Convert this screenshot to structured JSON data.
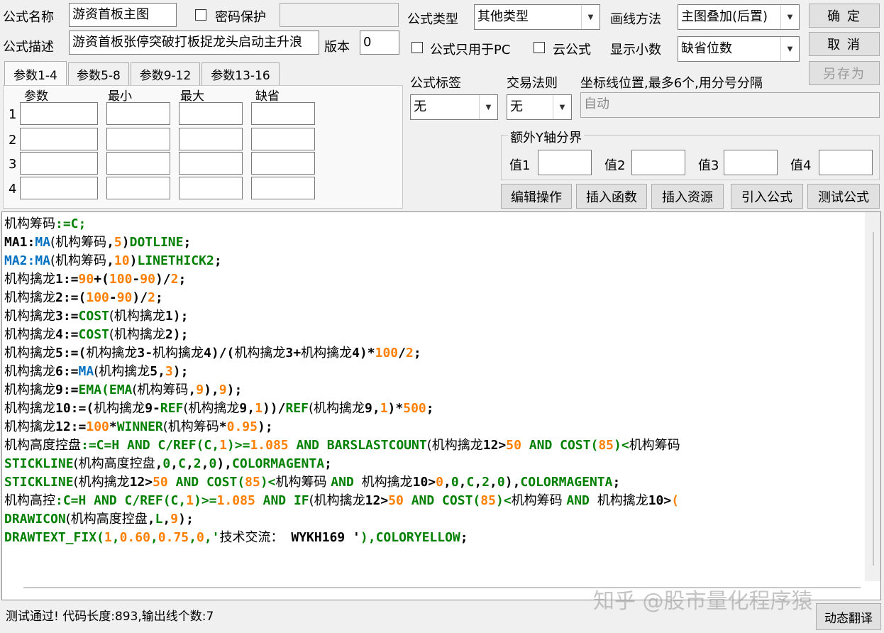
{
  "header": {
    "name_label": "公式名称",
    "name_value": "游资首板主图",
    "password_label": "密码保护",
    "desc_label": "公式描述",
    "desc_value": "游资首板张停突破打板捉龙头启动主升浪",
    "version_label": "版本",
    "version_value": "0"
  },
  "type": {
    "type_label": "公式类型",
    "type_value": "其他类型",
    "draw_label": "画线方法",
    "draw_value": "主图叠加(后置)",
    "pc_only_label": "公式只用于PC",
    "cloud_label": "云公式",
    "decimal_label": "显示小数",
    "decimal_value": "缺省位数"
  },
  "buttons": {
    "ok": "确  定",
    "cancel": "取  消",
    "save_as": "另存为",
    "edit_ops": "编辑操作",
    "insert_func": "插入函数",
    "insert_resource": "插入资源",
    "import_formula": "引入公式",
    "test_formula": "测试公式",
    "translate": "动态翻译"
  },
  "tabs": [
    "参数1-4",
    "参数5-8",
    "参数9-12",
    "参数13-16"
  ],
  "params": {
    "headers": [
      "参数",
      "最小",
      "最大",
      "缺省"
    ],
    "rows": [
      "1",
      "2",
      "3",
      "4"
    ]
  },
  "tags": {
    "tag_label": "公式标签",
    "tag_value": "无",
    "rule_label": "交易法则",
    "rule_value": "无",
    "axis_label": "坐标线位置,最多6个,用分号分隔",
    "axis_value": "自动"
  },
  "yaxis": {
    "group_label": "额外Y轴分界",
    "v1": "值1",
    "v2": "值2",
    "v3": "值3",
    "v4": "值4"
  },
  "code_lines": [
    [
      [
        "t",
        "机构筹码"
      ],
      [
        "",
        ""
      ],
      [
        "k",
        ":=C;"
      ]
    ],
    [
      [
        "b",
        "MA1:"
      ],
      [
        "f",
        "MA"
      ],
      [
        "t",
        "(机构筹码"
      ],
      [
        "b",
        ","
      ],
      [
        "n",
        "5"
      ],
      [
        "b",
        ")"
      ],
      [
        "k",
        "DOTLINE"
      ],
      [
        "b",
        ";"
      ]
    ],
    [
      [
        "f",
        "MA2:MA"
      ],
      [
        "t",
        "(机构筹码"
      ],
      [
        "b",
        ","
      ],
      [
        "n",
        "10"
      ],
      [
        "b",
        ")"
      ],
      [
        "k",
        "LINETHICK2"
      ],
      [
        "b",
        ";"
      ]
    ],
    [
      [
        "t",
        "机构擒龙"
      ],
      [
        "b",
        "1:="
      ],
      [
        "n",
        "90"
      ],
      [
        "b",
        "+("
      ],
      [
        "n",
        "100"
      ],
      [
        "b",
        "-"
      ],
      [
        "n",
        "90"
      ],
      [
        "b",
        ")/"
      ],
      [
        "n",
        "2"
      ],
      [
        "b",
        ";"
      ]
    ],
    [
      [
        "t",
        "机构擒龙"
      ],
      [
        "b",
        "2:=("
      ],
      [
        "n",
        "100"
      ],
      [
        "b",
        "-"
      ],
      [
        "n",
        "90"
      ],
      [
        "b",
        ")/"
      ],
      [
        "n",
        "2"
      ],
      [
        "b",
        ";"
      ]
    ],
    [
      [
        "t",
        "机构擒龙"
      ],
      [
        "b",
        "3:="
      ],
      [
        "k",
        "COST"
      ],
      [
        "t",
        "(机构擒龙"
      ],
      [
        "b",
        "1);"
      ]
    ],
    [
      [
        "t",
        "机构擒龙"
      ],
      [
        "b",
        "4:="
      ],
      [
        "k",
        "COST"
      ],
      [
        "t",
        "(机构擒龙"
      ],
      [
        "b",
        "2);"
      ]
    ],
    [
      [
        "t",
        "机构擒龙"
      ],
      [
        "b",
        "5:=("
      ],
      [
        "t",
        "机构擒龙"
      ],
      [
        "b",
        "3-"
      ],
      [
        "t",
        "机构擒龙"
      ],
      [
        "b",
        "4)/("
      ],
      [
        "t",
        "机构擒龙"
      ],
      [
        "b",
        "3+"
      ],
      [
        "t",
        "机构擒龙"
      ],
      [
        "b",
        "4)*"
      ],
      [
        "n",
        "100"
      ],
      [
        "b",
        "/"
      ],
      [
        "n",
        "2"
      ],
      [
        "b",
        ";"
      ]
    ],
    [
      [
        "t",
        "机构擒龙"
      ],
      [
        "b",
        "6:="
      ],
      [
        "f",
        "MA"
      ],
      [
        "t",
        "(机构擒龙"
      ],
      [
        "b",
        "5,"
      ],
      [
        "n",
        "3"
      ],
      [
        "b",
        ");"
      ]
    ],
    [
      [
        "t",
        "机构擒龙"
      ],
      [
        "b",
        "9:="
      ],
      [
        "k",
        "EMA(EMA"
      ],
      [
        "t",
        "(机构筹码"
      ],
      [
        "b",
        ","
      ],
      [
        "n",
        "9"
      ],
      [
        "b",
        "),"
      ],
      [
        "n",
        "9"
      ],
      [
        "b",
        ");"
      ]
    ],
    [
      [
        "t",
        "机构擒龙"
      ],
      [
        "b",
        "10:=("
      ],
      [
        "t",
        "机构擒龙"
      ],
      [
        "b",
        "9-"
      ],
      [
        "k",
        "REF"
      ],
      [
        "t",
        "(机构擒龙"
      ],
      [
        "b",
        "9,"
      ],
      [
        "n",
        "1"
      ],
      [
        "b",
        "))/"
      ],
      [
        "k",
        "REF"
      ],
      [
        "t",
        "(机构擒龙"
      ],
      [
        "b",
        "9,"
      ],
      [
        "n",
        "1"
      ],
      [
        "b",
        ")*"
      ],
      [
        "n",
        "500"
      ],
      [
        "b",
        ";"
      ]
    ],
    [
      [
        "t",
        "机构擒龙"
      ],
      [
        "b",
        "12:="
      ],
      [
        "n",
        "100"
      ],
      [
        "b",
        "*"
      ],
      [
        "k",
        "WINNER"
      ],
      [
        "t",
        "(机构筹码"
      ],
      [
        "b",
        "*"
      ],
      [
        "n",
        "0.95"
      ],
      [
        "b",
        ");"
      ]
    ],
    [
      [
        "t",
        "机构高度控盘"
      ],
      [
        "k",
        ":=C=H AND C/REF(C,"
      ],
      [
        "n",
        "1"
      ],
      [
        "k",
        ")>="
      ],
      [
        "n",
        "1.085"
      ],
      [
        "k",
        " AND BARSLASTCOUNT"
      ],
      [
        "t",
        "(机构擒龙"
      ],
      [
        "b",
        "12>"
      ],
      [
        "n",
        "50"
      ],
      [
        "k",
        " AND COST("
      ],
      [
        "n",
        "85"
      ],
      [
        "k",
        ")<"
      ],
      [
        "t",
        "机构筹码"
      ]
    ],
    [
      [
        "k",
        "STICKLINE"
      ],
      [
        "t",
        "(机构高度控盘"
      ],
      [
        "b",
        ","
      ],
      [
        "k",
        "0"
      ],
      [
        "b",
        ","
      ],
      [
        "k",
        "C"
      ],
      [
        "b",
        ","
      ],
      [
        "k",
        "2"
      ],
      [
        "b",
        ","
      ],
      [
        "k",
        "0"
      ],
      [
        "b",
        "),"
      ],
      [
        "k",
        "COLORMAGENTA"
      ],
      [
        "b",
        ";"
      ]
    ],
    [
      [
        "k",
        "STICKLINE"
      ],
      [
        "t",
        "(机构擒龙"
      ],
      [
        "b",
        "12>"
      ],
      [
        "n",
        "50"
      ],
      [
        "k",
        " AND COST("
      ],
      [
        "n",
        "85"
      ],
      [
        "k",
        ")<"
      ],
      [
        "t",
        "机构筹码 "
      ],
      [
        "k",
        "AND "
      ],
      [
        "t",
        "机构擒龙"
      ],
      [
        "b",
        "10>"
      ],
      [
        "n",
        "0"
      ],
      [
        "b",
        ","
      ],
      [
        "k",
        "0"
      ],
      [
        "b",
        ","
      ],
      [
        "k",
        "C"
      ],
      [
        "b",
        ","
      ],
      [
        "k",
        "2"
      ],
      [
        "b",
        ","
      ],
      [
        "k",
        "0"
      ],
      [
        "b",
        "),"
      ],
      [
        "k",
        "COLORMAGENTA"
      ],
      [
        "b",
        ";"
      ]
    ],
    [
      [
        "t",
        "机构高控"
      ],
      [
        "k",
        ":C=H AND C/REF(C,"
      ],
      [
        "n",
        "1"
      ],
      [
        "k",
        ")>="
      ],
      [
        "n",
        "1.085"
      ],
      [
        "k",
        " AND IF"
      ],
      [
        "t",
        "(机构擒龙"
      ],
      [
        "b",
        "12>"
      ],
      [
        "n",
        "50"
      ],
      [
        "k",
        " AND COST("
      ],
      [
        "n",
        "85"
      ],
      [
        "k",
        ")<"
      ],
      [
        "t",
        "机构筹码 "
      ],
      [
        "k",
        "AND "
      ],
      [
        "t",
        "机构擒龙"
      ],
      [
        "b",
        "10>"
      ],
      [
        "n",
        "("
      ]
    ],
    [
      [
        "k",
        "DRAWICON"
      ],
      [
        "t",
        "(机构高度控盘"
      ],
      [
        "b",
        ","
      ],
      [
        "k",
        "L"
      ],
      [
        "b",
        ","
      ],
      [
        "n",
        "9"
      ],
      [
        "b",
        ");"
      ]
    ],
    [
      [
        "k",
        "DRAWTEXT_FIX("
      ],
      [
        "n",
        "1"
      ],
      [
        "k",
        ","
      ],
      [
        "n",
        "0.60"
      ],
      [
        "k",
        ","
      ],
      [
        "n",
        "0.75"
      ],
      [
        "k",
        ","
      ],
      [
        "n",
        "0"
      ],
      [
        "k",
        ",'"
      ],
      [
        "t",
        "技术交流："
      ],
      [
        "b",
        " WYKH169 '"
      ],
      [
        "k",
        "),COLORYELLOW"
      ],
      [
        "b",
        ";"
      ]
    ]
  ],
  "status_text": "测试通过! 代码长度:893,输出线个数:7",
  "watermark": "知乎 @股市量化程序猿"
}
